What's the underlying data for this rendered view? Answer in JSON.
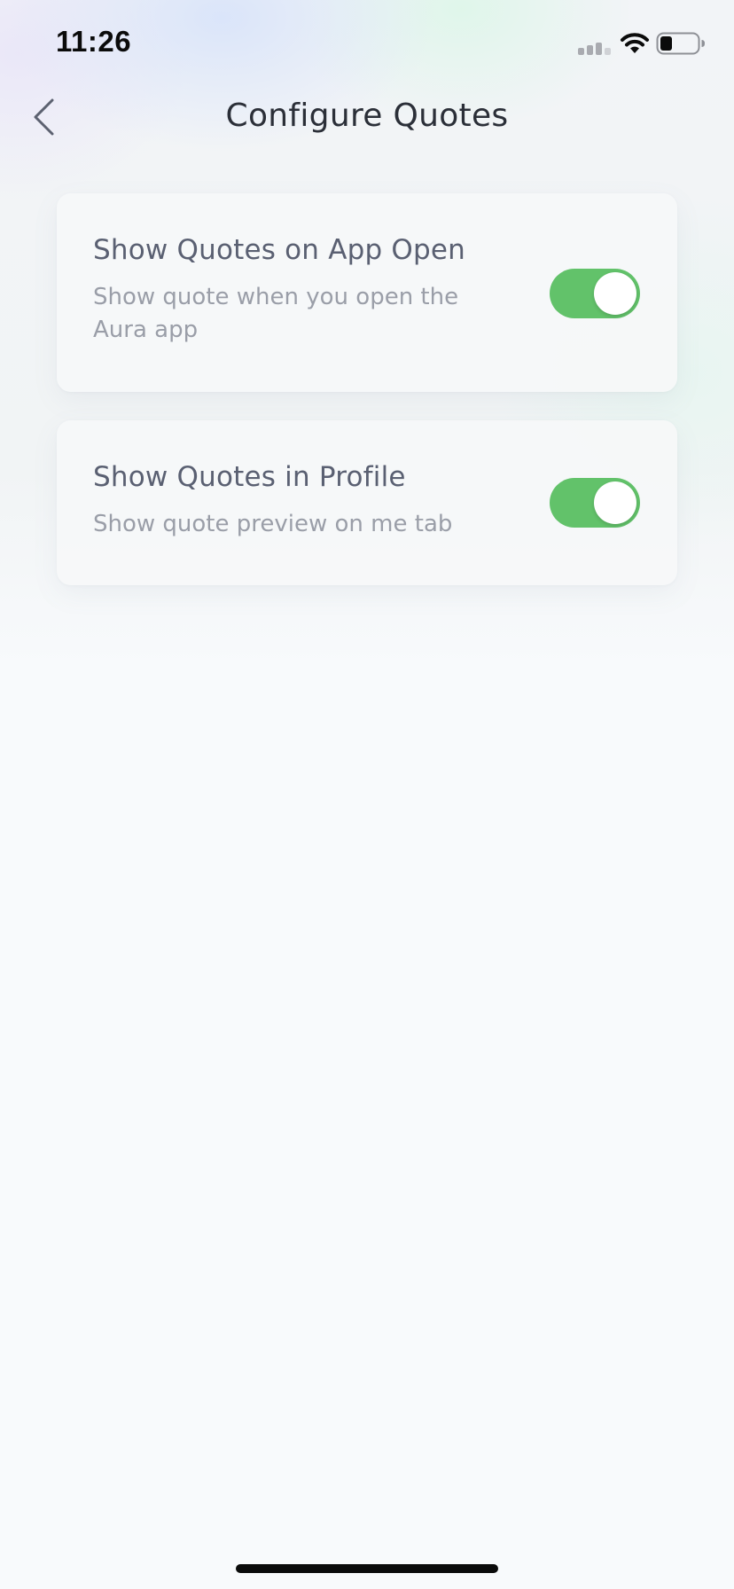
{
  "status_bar": {
    "time": "11:26"
  },
  "nav": {
    "title": "Configure Quotes"
  },
  "settings": [
    {
      "title": "Show Quotes on App Open",
      "description": "Show quote when you open the Aura app",
      "enabled": true
    },
    {
      "title": "Show Quotes in Profile",
      "description": "Show quote preview on me tab",
      "enabled": true
    }
  ],
  "colors": {
    "toggle_on": "#62c26a",
    "title_text": "#5a6072",
    "description_text": "#9a9ea8"
  },
  "icons": {
    "back": "chevron-left-icon",
    "signal": "cellular-signal-icon",
    "wifi": "wifi-icon",
    "battery": "battery-icon"
  }
}
